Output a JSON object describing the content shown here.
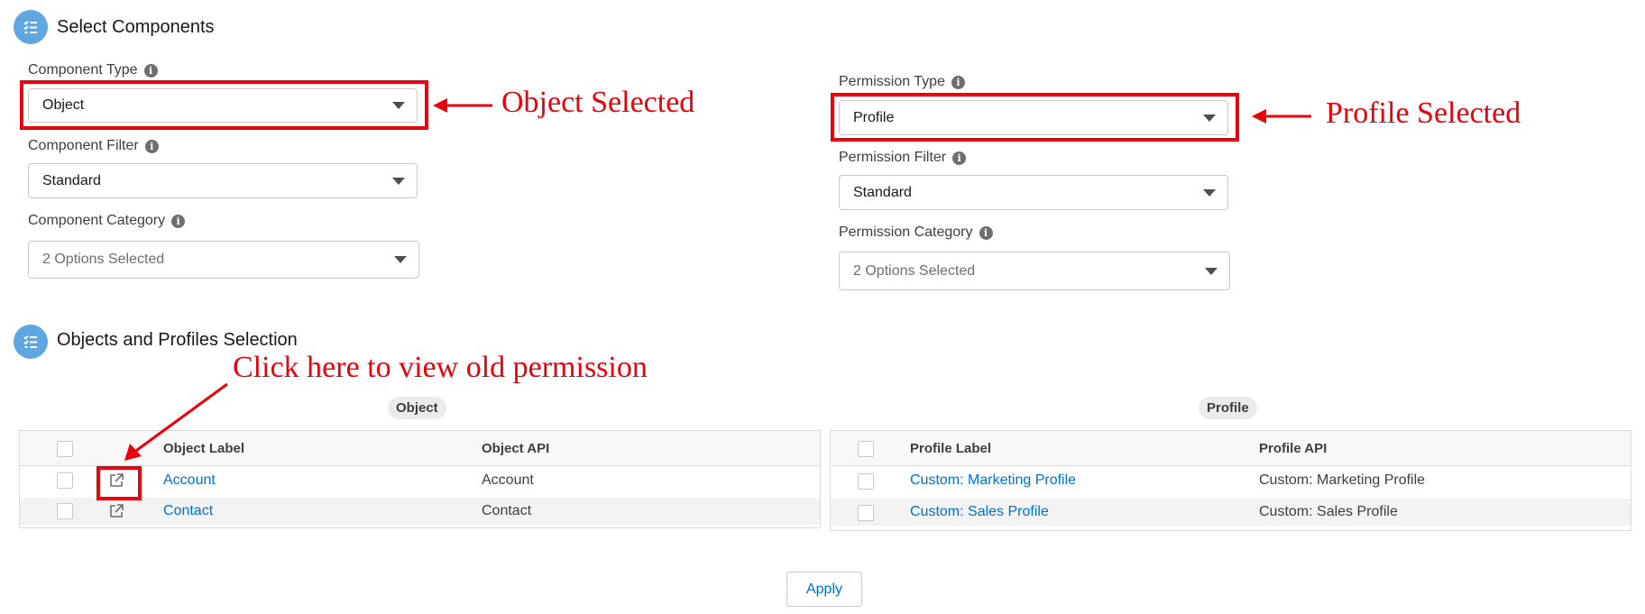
{
  "sections": {
    "select_components": {
      "title": "Select Components"
    },
    "selection": {
      "title": "Objects and Profiles Selection"
    }
  },
  "component": {
    "type_label": "Component Type",
    "type_value": "Object",
    "filter_label": "Component Filter",
    "filter_value": "Standard",
    "category_label": "Component Category",
    "category_value": "2 Options Selected"
  },
  "permission": {
    "type_label": "Permission Type",
    "type_value": "Profile",
    "filter_label": "Permission Filter",
    "filter_value": "Standard",
    "category_label": "Permission Category",
    "category_value": "2 Options Selected"
  },
  "annotations": {
    "object_selected": "Object Selected",
    "profile_selected": "Profile Selected",
    "click_here": "Click here to view old permission"
  },
  "object_table": {
    "pill": "Object",
    "headers": [
      "Object Label",
      "Object API"
    ],
    "rows": [
      {
        "label": "Account",
        "api": "Account"
      },
      {
        "label": "Contact",
        "api": "Contact"
      }
    ]
  },
  "profile_table": {
    "pill": "Profile",
    "headers": [
      "Profile Label",
      "Profile API"
    ],
    "rows": [
      {
        "label": "Custom: Marketing Profile",
        "api": "Custom: Marketing Profile"
      },
      {
        "label": "Custom: Sales Profile",
        "api": "Custom: Sales Profile"
      }
    ]
  },
  "apply_label": "Apply",
  "icons": {
    "section": "checklist-icon",
    "info": "info-icon",
    "external": "external-link-icon",
    "caret": "caret-down-icon"
  },
  "colors": {
    "accent": "#0070d2",
    "annotation": "#e8000b",
    "section_icon": "#5ea7e0"
  }
}
